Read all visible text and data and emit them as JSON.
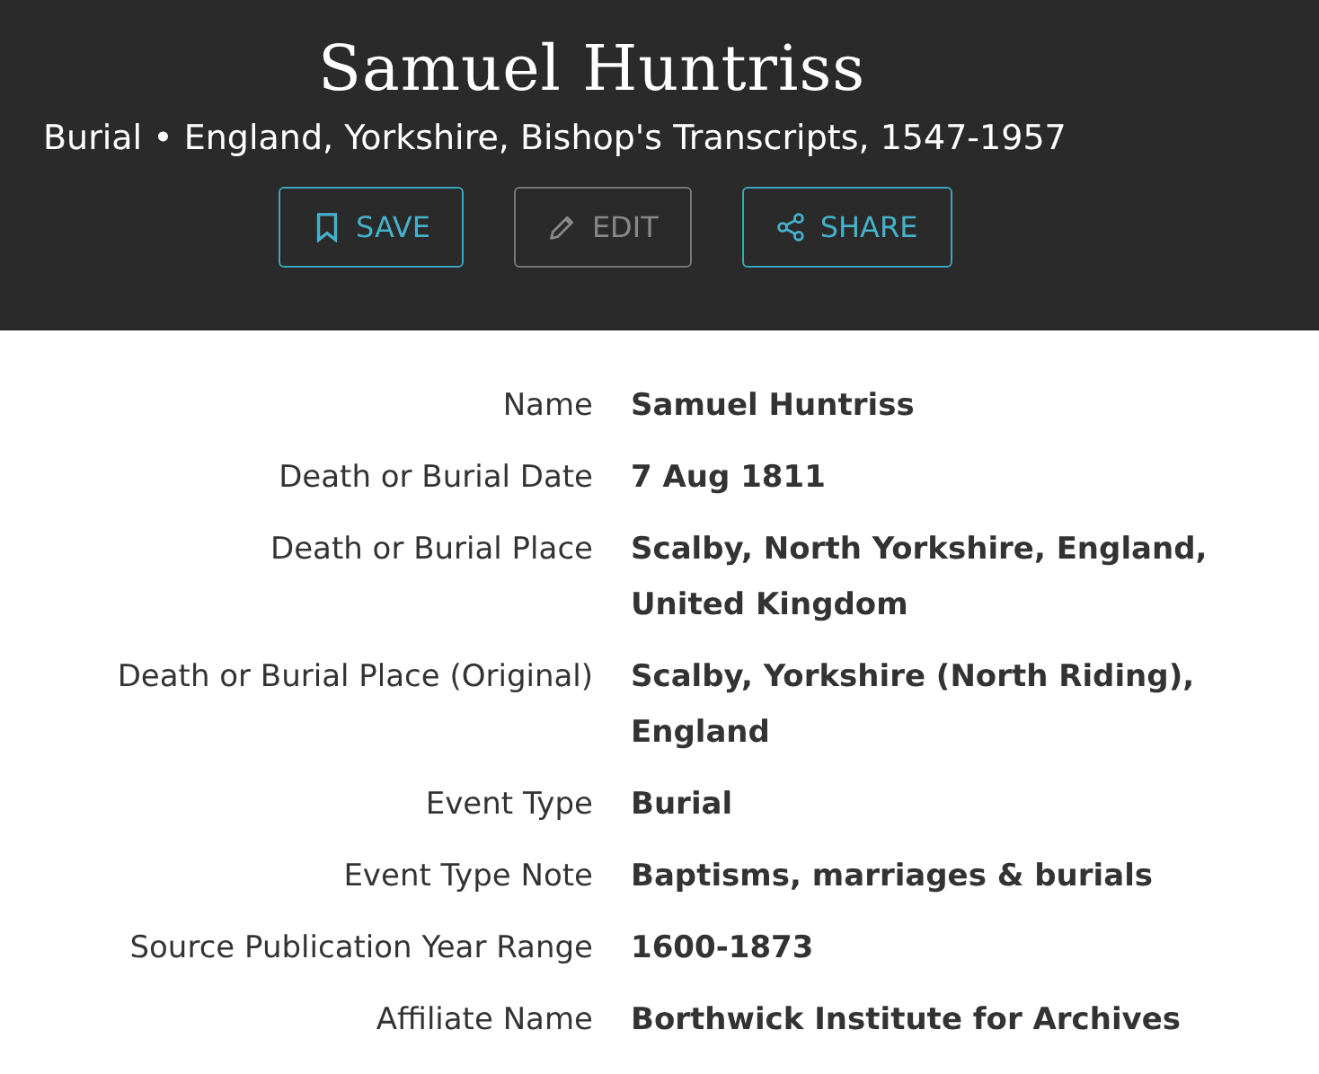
{
  "header": {
    "title": "Samuel Huntriss",
    "subtitle": "Burial • England, Yorkshire, Bishop's Transcripts, 1547-1957",
    "buttons": [
      {
        "kind": "save",
        "label": "SAVE",
        "disabled": false
      },
      {
        "kind": "edit",
        "label": "EDIT",
        "disabled": true
      },
      {
        "kind": "share",
        "label": "SHARE",
        "disabled": false
      }
    ]
  },
  "fields": [
    {
      "label": "Name",
      "value": "Samuel Huntriss"
    },
    {
      "label": "Death or Burial Date",
      "value": "7 Aug 1811"
    },
    {
      "label": "Death or Burial Place",
      "value": "Scalby, North Yorkshire, England, United Kingdom"
    },
    {
      "label": "Death or Burial Place (Original)",
      "value": "Scalby, Yorkshire (North Riding), England"
    },
    {
      "label": "Event Type",
      "value": "Burial"
    },
    {
      "label": "Event Type Note",
      "value": "Baptisms, marriages & burials"
    },
    {
      "label": "Source Publication Year Range",
      "value": "1600-1873"
    },
    {
      "label": "Affiliate Name",
      "value": "Borthwick Institute for Archives"
    }
  ]
}
